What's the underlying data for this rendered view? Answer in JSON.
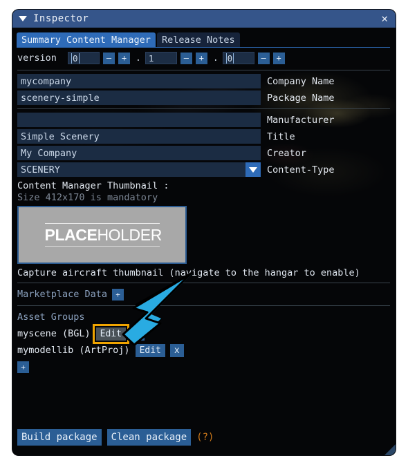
{
  "window": {
    "title": "Inspector",
    "collapse_icon": "triangle-down-icon",
    "close_icon": "close-icon"
  },
  "tabs": [
    {
      "label": "Summary Content Manager",
      "active": true
    },
    {
      "label": "Release Notes",
      "active": false
    }
  ],
  "version": {
    "label": "version",
    "major": "0",
    "minor": "1",
    "patch": "0",
    "separator": ".",
    "minus_label": "–",
    "plus_label": "+"
  },
  "fields": [
    {
      "value": "mycompany",
      "label": "Company Name",
      "type": "text"
    },
    {
      "value": "scenery-simple",
      "label": "Package Name",
      "type": "text"
    },
    {
      "value": "",
      "label": "Manufacturer",
      "type": "text"
    },
    {
      "value": "Simple Scenery",
      "label": "Title",
      "type": "text"
    },
    {
      "value": "My Company",
      "label": "Creator",
      "type": "text"
    },
    {
      "value": "SCENERY",
      "label": "Content-Type",
      "type": "dropdown"
    }
  ],
  "thumbnail": {
    "caption": "Content Manager Thumbnail :",
    "requirement": "Size 412x170 is mandatory",
    "placeholder_bold": "PLACE",
    "placeholder_regular": "HOLDER"
  },
  "capture": {
    "text": "Capture aircraft thumbnail (navigate to the hangar to enable)"
  },
  "marketplace": {
    "label": "Marketplace Data",
    "add_label": "+"
  },
  "asset_groups": {
    "label": "Asset Groups",
    "add_label": "+",
    "items": [
      {
        "name": "myscene (BGL)",
        "edit_label": "Edit",
        "delete_label": "x",
        "highlighted": true
      },
      {
        "name": "mymodellib (ArtProj)",
        "edit_label": "Edit",
        "delete_label": "x",
        "highlighted": false
      }
    ]
  },
  "footer": {
    "build_label": "Build package",
    "clean_label": "Clean package",
    "help_label": "(?)"
  },
  "annotation": {
    "arrow_color": "#29ABE2",
    "arrow_outline": "#000000",
    "highlight_color": "#f0a400"
  }
}
